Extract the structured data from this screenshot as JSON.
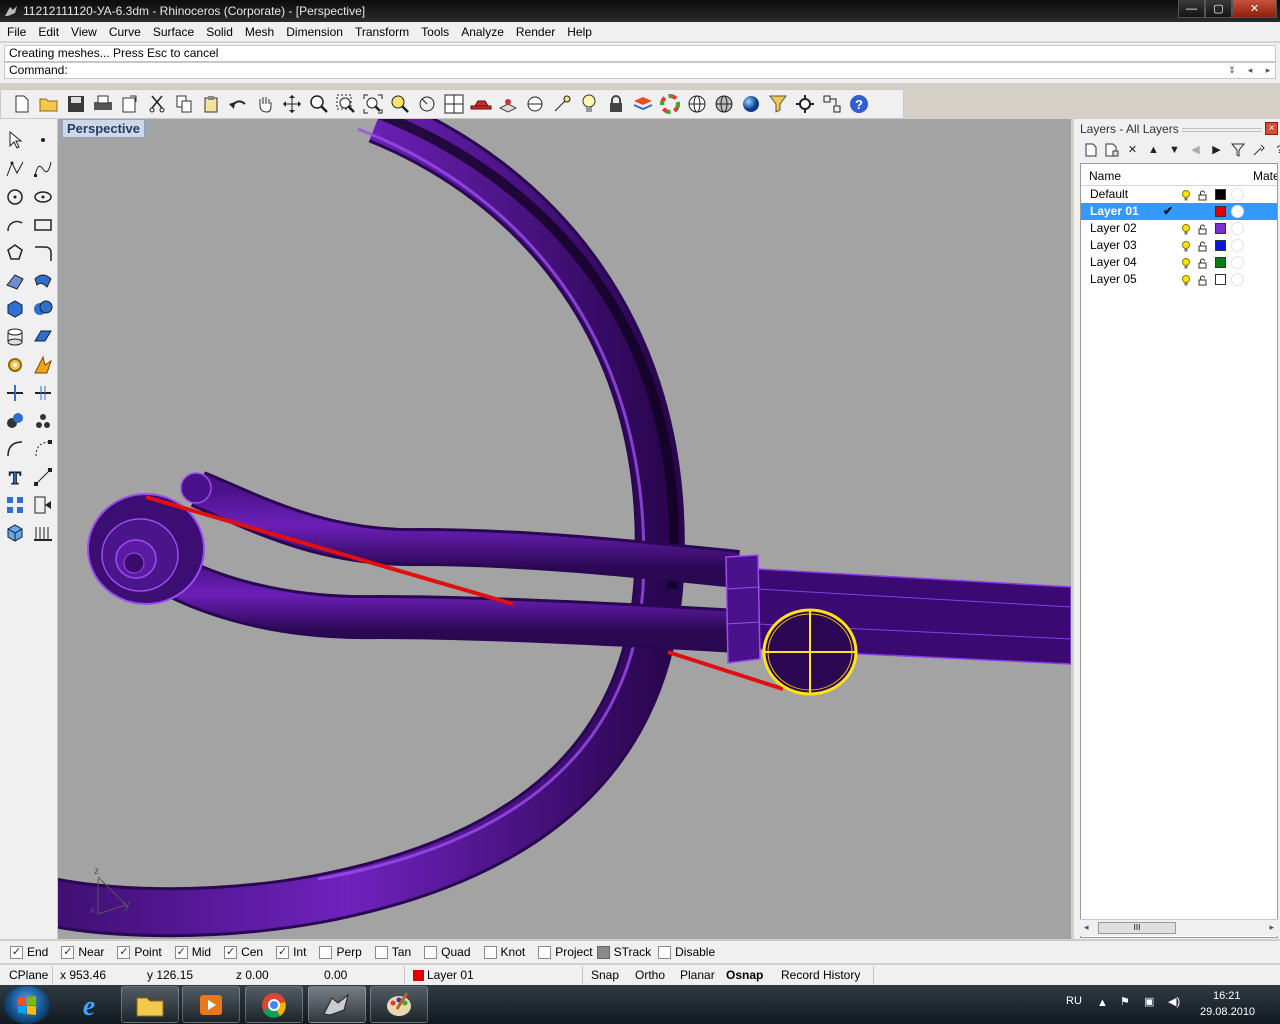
{
  "window": {
    "title": "11212111120-УА-6.3dm - Rhinoceros (Corporate) - [Perspective]",
    "btn_minimize": "—",
    "btn_maximize": "▢",
    "btn_close": "✕"
  },
  "menu": [
    "File",
    "Edit",
    "View",
    "Curve",
    "Surface",
    "Solid",
    "Mesh",
    "Dimension",
    "Transform",
    "Tools",
    "Analyze",
    "Render",
    "Help"
  ],
  "command": {
    "history": "Creating meshes... Press Esc to cancel",
    "prompt": "Command:"
  },
  "viewport": {
    "label": "Perspective",
    "axis_y": "y",
    "axis_z": "z",
    "axis_x": "x"
  },
  "layers_panel": {
    "title": "Layers - All Layers",
    "col_name": "Name",
    "col_material": "Mater",
    "rows": [
      {
        "name": "Default",
        "color": "#000000",
        "selected": false
      },
      {
        "name": "Layer 01",
        "color": "#e00000",
        "selected": true
      },
      {
        "name": "Layer 02",
        "color": "#7b2fd0",
        "selected": false
      },
      {
        "name": "Layer 03",
        "color": "#0a14e0",
        "selected": false
      },
      {
        "name": "Layer 04",
        "color": "#0a7a12",
        "selected": false
      },
      {
        "name": "Layer 05",
        "color": "#ffffff",
        "selected": false
      }
    ],
    "current_check": "✔",
    "scroll_grip": "III"
  },
  "osnaps": [
    {
      "label": "End",
      "checked": true
    },
    {
      "label": "Near",
      "checked": true
    },
    {
      "label": "Point",
      "checked": true
    },
    {
      "label": "Mid",
      "checked": true
    },
    {
      "label": "Cen",
      "checked": true
    },
    {
      "label": "Int",
      "checked": true
    },
    {
      "label": "Perp",
      "checked": false
    },
    {
      "label": "Tan",
      "checked": false
    },
    {
      "label": "Quad",
      "checked": false
    },
    {
      "label": "Knot",
      "checked": false
    }
  ],
  "osnap_extra": {
    "project": "Project",
    "strack": "STrack",
    "disable": "Disable"
  },
  "status": {
    "cplane": "CPlane",
    "x": "x 953.46",
    "y": "y 126.15",
    "z": "z 0.00",
    "dist": "0.00",
    "layer": "Layer 01",
    "layer_color": "#e00000",
    "snap": "Snap",
    "ortho": "Ortho",
    "planar": "Planar",
    "osnap": "Osnap",
    "record_history": "Record History"
  },
  "tray": {
    "lang": "RU",
    "time": "16:21",
    "date": "29.08.2010"
  }
}
